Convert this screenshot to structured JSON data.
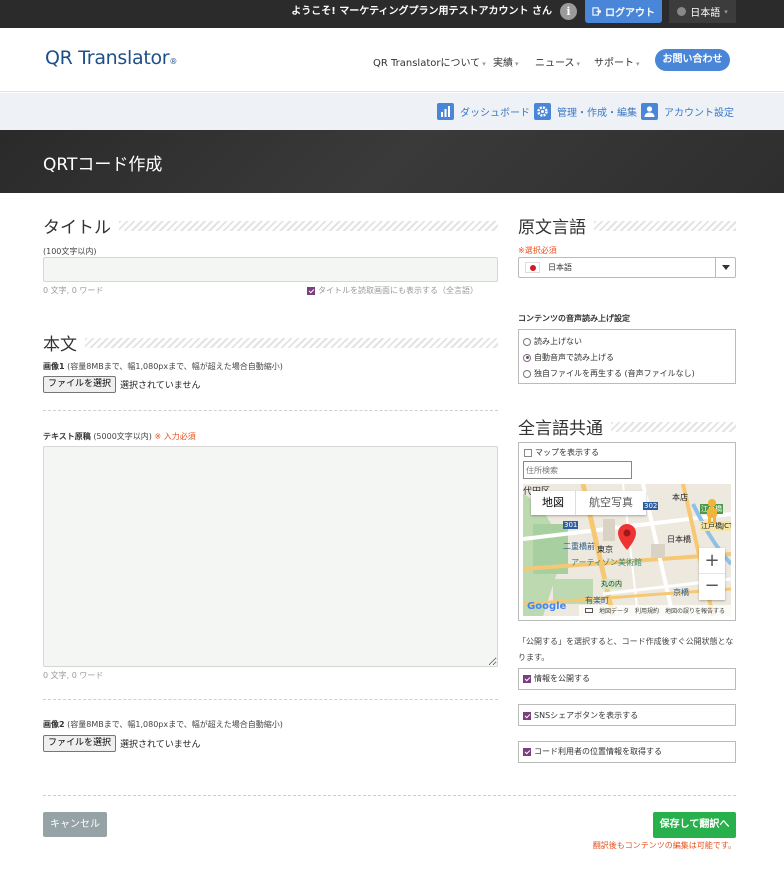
{
  "topbar": {
    "welcome": "ようこそ! マーケティングプラン用テストアカウント さん",
    "info_glyph": "i",
    "logout": "ログアウト",
    "language": "日本語",
    "language_caret": "▾"
  },
  "header": {
    "logo": "QR Translator",
    "logo_mark": "®",
    "nav": [
      {
        "label": "QR Translatorについて"
      },
      {
        "label": "実績"
      },
      {
        "label": "ニュース"
      },
      {
        "label": "サポート"
      }
    ],
    "nav_caret": "▾",
    "contact": "お問い合わせ"
  },
  "subnav": {
    "dashboard": "ダッシュボード",
    "manage": "管理・作成・編集",
    "account": "アカウント設定"
  },
  "page_title": "QRTコード作成",
  "left": {
    "title_heading": "タイトル",
    "title_hint": "(100文字以内)",
    "title_value": "",
    "title_count": "0 文字, 0 ワード",
    "title_show_label": "タイトルを読取画面にも表示する（全言語）",
    "body_heading": "本文",
    "image1_label": "画像1",
    "image_hint": "(容量8MBまで、幅1,080pxまで、幅が超えた場合自動縮小)",
    "file_button": "ファイルを選択",
    "file_none": "選択されていません",
    "text_label": "テキスト原稿",
    "text_hint": "(5000文字以内)",
    "required_mark": "※ 入力必須",
    "text_value": "",
    "text_count": "0 文字, 0 ワード",
    "image2_label": "画像2"
  },
  "right": {
    "source_heading": "原文言語",
    "source_required": "※選択必須",
    "source_value": "日本語",
    "tts_heading": "コンテンツの音声読み上げ設定",
    "tts_options": [
      {
        "label": "読み上げない",
        "selected": false
      },
      {
        "label": "自動音声で読み上げる",
        "selected": true
      },
      {
        "label": "独自ファイルを再生する (音声ファイルなし)",
        "selected": false
      }
    ],
    "common_heading": "全言語共通",
    "map_show_label": "マップを表示する",
    "address_placeholder": "住所検索",
    "map_tab_map": "地図",
    "map_tab_satellite": "航空写真",
    "map_labels": {
      "district": "代田区",
      "nijubashi": "二重橋前",
      "tokyo": "東京",
      "artizon": "アーティゾン美術館",
      "nihonbashi": "日本橋",
      "marunouchi": "丸の内",
      "yurakucho": "有楽町",
      "kyobashi": "京橋",
      "store": "本店",
      "edobashi": "江戸橋",
      "jct": "江戸橋JCT",
      "route_301": "301",
      "route_302": "302",
      "zoom_in": "+",
      "zoom_out": "−",
      "google": "Google",
      "map_data": "地図データ",
      "terms": "利用規約",
      "report": "地図の誤りを報告する"
    },
    "publish_note": "「公開する」を選択すると、コード作成後すぐ公開状態となります。",
    "checks": [
      {
        "label": "情報を公開する",
        "checked": true
      },
      {
        "label": "SNSシェアボタンを表示する",
        "checked": true
      },
      {
        "label": "コード利用者の位置情報を取得する",
        "checked": true
      }
    ]
  },
  "footer": {
    "cancel": "キャンセル",
    "save": "保存して翻訳へ",
    "note": "翻訳後もコンテンツの編集は可能です。"
  },
  "colors": {
    "accent": "#4a86d8",
    "save": "#27b04b",
    "required": "#e8531f",
    "check": "#7a3f7e"
  }
}
